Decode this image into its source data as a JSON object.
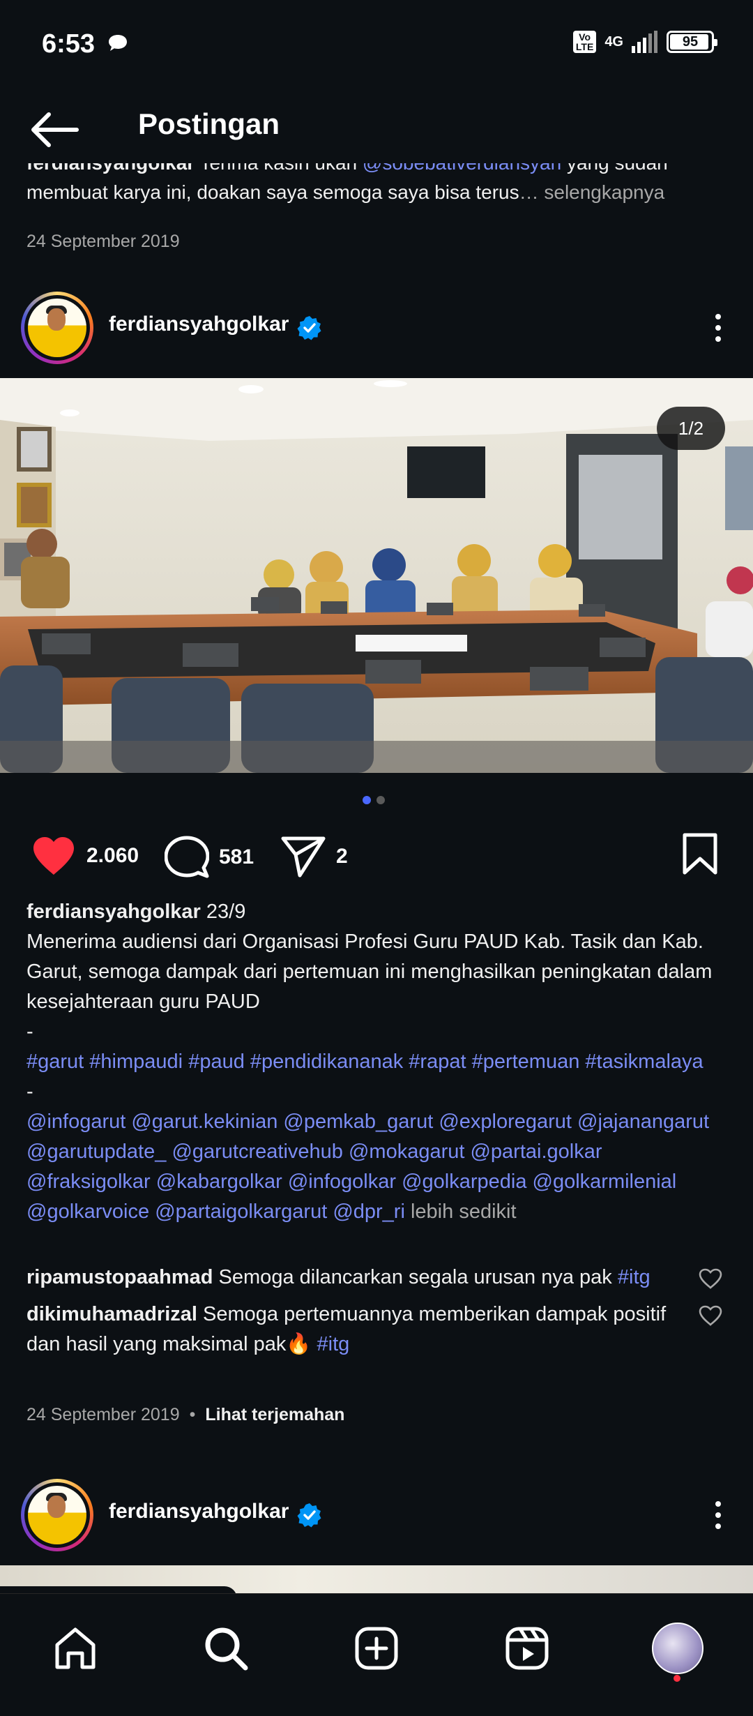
{
  "status_bar": {
    "time": "6:53",
    "volte": "Vo\nLTE",
    "network": "4G",
    "battery": "95",
    "battery_fraction": 0.95
  },
  "header": {
    "title": "Postingan",
    "back_icon": "arrow-left-icon"
  },
  "previous_post": {
    "line1_user": "ferdiansyahgolkar",
    "line1_text": " Terima kasih ukan ",
    "line1_mention": "@sobebativerdiansyah",
    "line1_rest": " yang sudah",
    "line2_text": "membuat karya ini, doakan saya semoga saya bisa terus",
    "line2_more": "… selengkapnya",
    "date": "24 September 2019"
  },
  "post": {
    "username": "ferdiansyahgolkar",
    "verified_icon": "verified-badge-icon",
    "more_icon": "more-vertical-icon",
    "image_counter": "1/2",
    "likes": "2.060",
    "comments_count": "581",
    "shares": "2",
    "caption_user": "ferdiansyahgolkar",
    "caption_date": "23/9",
    "caption_text": "Menerima audiensi dari Organisasi Profesi Guru PAUD Kab. Tasik dan Kab. Garut, semoga dampak dari pertemuan ini menghasilkan peningkatan dalam kesejahteraan guru PAUD",
    "separator": "-",
    "hashtags": [
      "#garut",
      "#himpaudi",
      "#paud",
      "#pendidikananak",
      "#rapat",
      "#pertemuan",
      "#tasikmalaya"
    ],
    "mentions": [
      "@infogarut",
      "@garut.kekinian",
      "@pemkab_garut",
      "@exploregarut",
      "@jajanangarut",
      "@garutupdate_",
      "@garutcreativehub",
      "@mokagarut",
      "@partai.golkar",
      "@fraksigolkar",
      "@kabargolkar",
      "@infogolkar",
      "@golkarpedia",
      "@golkarmilenial",
      "@golkarvoice",
      "@partaigolkargarut",
      "@dpr_ri"
    ],
    "less_label": "lebih sedikit",
    "comments": [
      {
        "user": "ripamustopaahmad",
        "text": " Semoga dilancarkan segala urusan nya pak ",
        "tag": "#itg"
      },
      {
        "user": "dikimuhamadrizal",
        "text": " Semoga pertemuannya memberikan dampak positif dan hasil yang maksimal pak🔥 ",
        "tag": "#itg"
      }
    ],
    "date": "24 September 2019",
    "footer_sep": "•",
    "translate_label": "Lihat terjemahan"
  },
  "next_post": {
    "username": "ferdiansyahgolkar"
  },
  "bottom_nav": {
    "items": [
      "home-icon",
      "search-icon",
      "create-icon",
      "reels-icon",
      "profile-avatar"
    ]
  },
  "colors": {
    "background": "#0c1014",
    "link": "#7b8df5",
    "like_red": "#ff3040",
    "verified_blue": "#0095f6"
  }
}
